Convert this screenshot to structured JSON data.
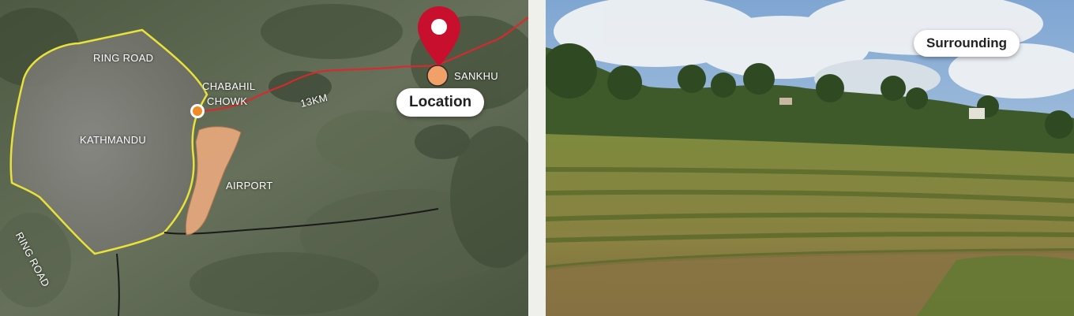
{
  "map": {
    "labels": {
      "ring_road_top": "RING ROAD",
      "ring_road_left": "RING ROAD",
      "kathmandu": "KATHMANDU",
      "chabahil": "CHABAHIL",
      "chowk": "CHOWK",
      "airport": "AIRPORT",
      "distance": "13KM",
      "sankhu": "SANKHU"
    },
    "location_badge": "Location",
    "colors": {
      "ring_road": "#e8e23a",
      "route": "#e0262a",
      "airport_fill": "#e8a97e",
      "marker_pin": "#c8102e",
      "origin_dot": "#f08a24"
    }
  },
  "photo": {
    "badge": "Surrounding"
  }
}
